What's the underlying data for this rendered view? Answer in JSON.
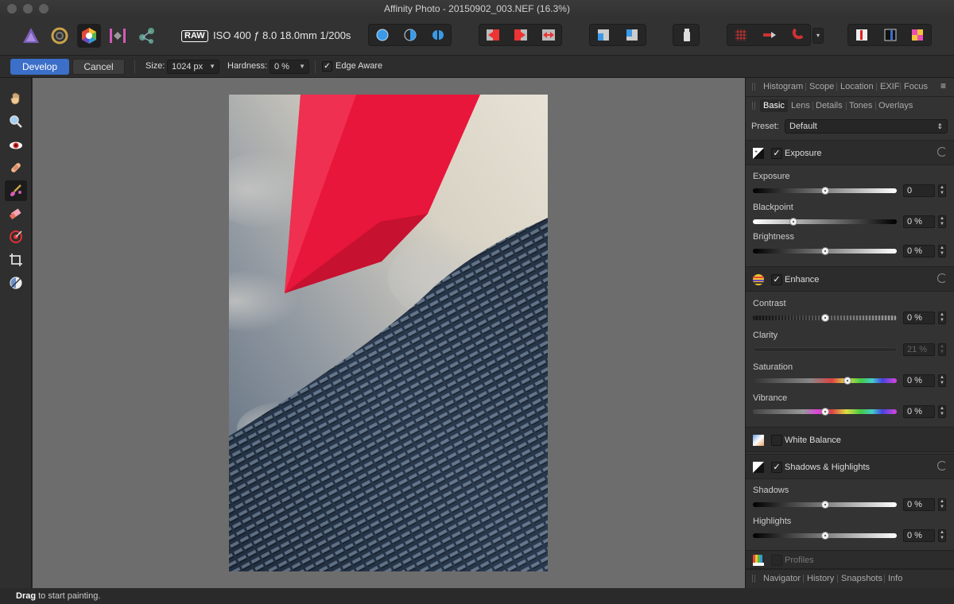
{
  "window": {
    "title": "Affinity Photo - 20150902_003.NEF (16.3%)"
  },
  "toolbar": {
    "raw_badge": "RAW",
    "raw_info": "ISO 400 ƒ 8.0 18.0mm 1/200s"
  },
  "context": {
    "develop_label": "Develop",
    "cancel_label": "Cancel",
    "size_label": "Size:",
    "size_value": "1024 px",
    "hardness_label": "Hardness:",
    "hardness_value": "0 %",
    "edge_aware_label": "Edge Aware",
    "edge_aware_checked": true
  },
  "tools": [
    "hand-icon",
    "zoom-icon",
    "red-eye-icon",
    "blemish-icon",
    "overlay-brush-icon",
    "overlay-eraser-icon",
    "overlay-gradient-icon",
    "crop-icon",
    "white-balance-picker-icon"
  ],
  "panel": {
    "top_tabs": [
      "Histogram",
      "Scope",
      "Location",
      "EXIF",
      "Focus"
    ],
    "sub_tabs": [
      "Basic",
      "Lens",
      "Details",
      "Tones",
      "Overlays"
    ],
    "preset_label": "Preset:",
    "preset_value": "Default",
    "exposure": {
      "title": "Exposure",
      "exposure_label": "Exposure",
      "exposure_value": "0",
      "blackpoint_label": "Blackpoint",
      "blackpoint_value": "0 %",
      "brightness_label": "Brightness",
      "brightness_value": "0 %"
    },
    "enhance": {
      "title": "Enhance",
      "contrast_label": "Contrast",
      "contrast_value": "0 %",
      "clarity_label": "Clarity",
      "clarity_value": "21 %",
      "saturation_label": "Saturation",
      "saturation_value": "0 %",
      "vibrance_label": "Vibrance",
      "vibrance_value": "0 %"
    },
    "white_balance": {
      "title": "White Balance"
    },
    "shadows_highlights": {
      "title": "Shadows & Highlights",
      "shadows_label": "Shadows",
      "shadows_value": "0 %",
      "highlights_label": "Highlights",
      "highlights_value": "0 %"
    },
    "profiles": {
      "title": "Profiles"
    },
    "bottom_tabs": [
      "Navigator",
      "History",
      "Snapshots",
      "Info"
    ]
  },
  "status": {
    "bold": "Drag",
    "text": " to start painting."
  }
}
